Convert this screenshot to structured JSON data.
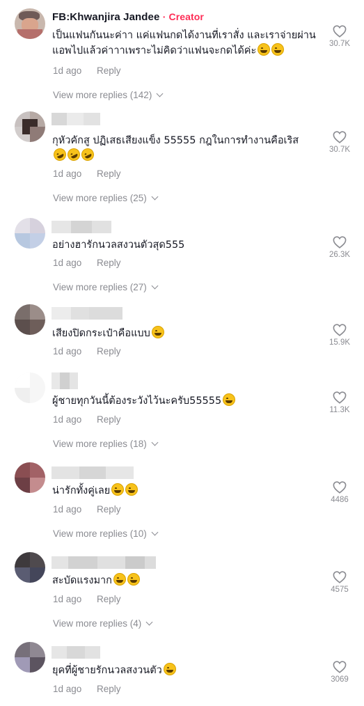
{
  "comments": [
    {
      "username": "FB:Khwanjira Jandee",
      "badge": "Creator",
      "text": "เป็นแฟนกันนะค่าา แค่แฟนกดได้งานที่เราสั่ง และเราจ่ายผ่านแอพไปแล้วค่าาาเพราะไม่คิดว่าแฟนจะกดได้ค่ะ",
      "emoji": [
        "grinning-sweat-emoji",
        "grinning-sweat-emoji"
      ],
      "date": "1d ago",
      "reply": "Reply",
      "likes": "30.7K",
      "view_more": "View more replies (142)"
    },
    {
      "text": "กุหัวคักสู ปฏิเสธเสียงแข็ง 55555 กฎในการทำงานคือเริส",
      "emoji": [
        "rofl-emoji",
        "rofl-emoji",
        "rofl-emoji"
      ],
      "date": "1d ago",
      "reply": "Reply",
      "likes": "30.7K",
      "view_more": "View more replies (25)"
    },
    {
      "text": "อย่างฮารักนวลสงวนตัวสุด555",
      "emoji": [],
      "date": "1d ago",
      "reply": "Reply",
      "likes": "26.3K",
      "view_more": "View more replies (27)"
    },
    {
      "text": "เสียงปิดกระเป๋าคือแบบ",
      "emoji": [
        "laughing-emoji"
      ],
      "date": "1d ago",
      "reply": "Reply",
      "likes": "15.9K",
      "view_more": ""
    },
    {
      "text": "ผู้ชายทุกวันนี้ต้องระวังไว้นะครับ55555",
      "emoji": [
        "laughing-emoji"
      ],
      "date": "1d ago",
      "reply": "Reply",
      "likes": "11.3K",
      "view_more": "View more replies (18)"
    },
    {
      "text": "น่ารักทั้งคู่เลย",
      "emoji": [
        "grinning-emoji",
        "grinning-emoji"
      ],
      "date": "1d ago",
      "reply": "Reply",
      "likes": "4486",
      "view_more": "View more replies (10)"
    },
    {
      "text": "สะบัดแรงมาก",
      "emoji": [
        "laughing-emoji",
        "laughing-emoji"
      ],
      "date": "1d ago",
      "reply": "Reply",
      "likes": "4575",
      "view_more": "View more replies (4)"
    },
    {
      "text": "ยุคที่ผู้ชายรักนวลสงวนตัว",
      "emoji": [
        "laughing-emoji"
      ],
      "date": "1d ago",
      "reply": "Reply",
      "likes": "3069",
      "view_more": ""
    }
  ],
  "colors": {
    "creator_badge": "#fe2c55",
    "secondary_text": "#8a8b91",
    "primary_text": "#161823"
  },
  "icons": {
    "like": "heart-outline-icon",
    "expand": "chevron-down-icon"
  }
}
